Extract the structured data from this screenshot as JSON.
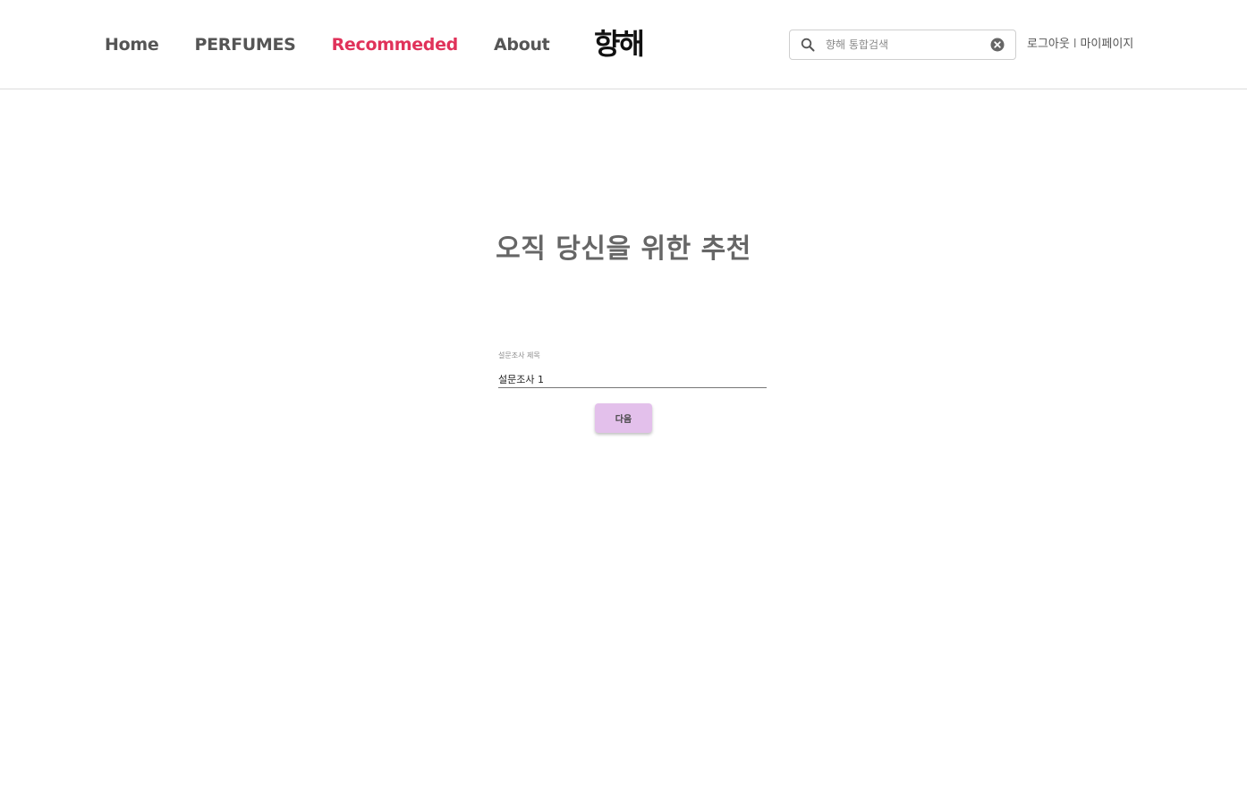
{
  "header": {
    "nav": [
      {
        "label": "Home",
        "active": false
      },
      {
        "label": "PERFUMES",
        "active": false
      },
      {
        "label": "Recommeded",
        "active": true
      },
      {
        "label": "About",
        "active": false
      }
    ],
    "logo": "향해",
    "search": {
      "placeholder": "향해 통합검색",
      "value": "",
      "icon": "search-icon",
      "clear_icon": "close-circle-icon"
    },
    "user_links": {
      "logout": "로그아웃",
      "separator": "l",
      "mypage": "마이페이지"
    }
  },
  "main": {
    "title": "오직 당신을 위한 추천",
    "survey_field": {
      "label": "설문조사 제목",
      "value": "설문조사 1"
    },
    "next_button": "다음"
  },
  "colors": {
    "accent_active_nav": "#e0325a",
    "button_bg": "#e3c0eb",
    "text_gray": "#555555"
  }
}
